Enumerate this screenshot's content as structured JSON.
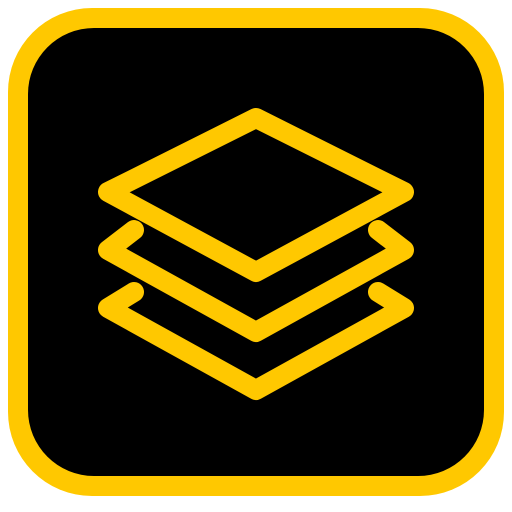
{
  "icon": {
    "name": "layers-icon",
    "layer_count": 3,
    "colors": {
      "frame": "#FFC800",
      "background": "#000000",
      "glyph": "#FFC800",
      "page": "#FFFFFF"
    }
  }
}
